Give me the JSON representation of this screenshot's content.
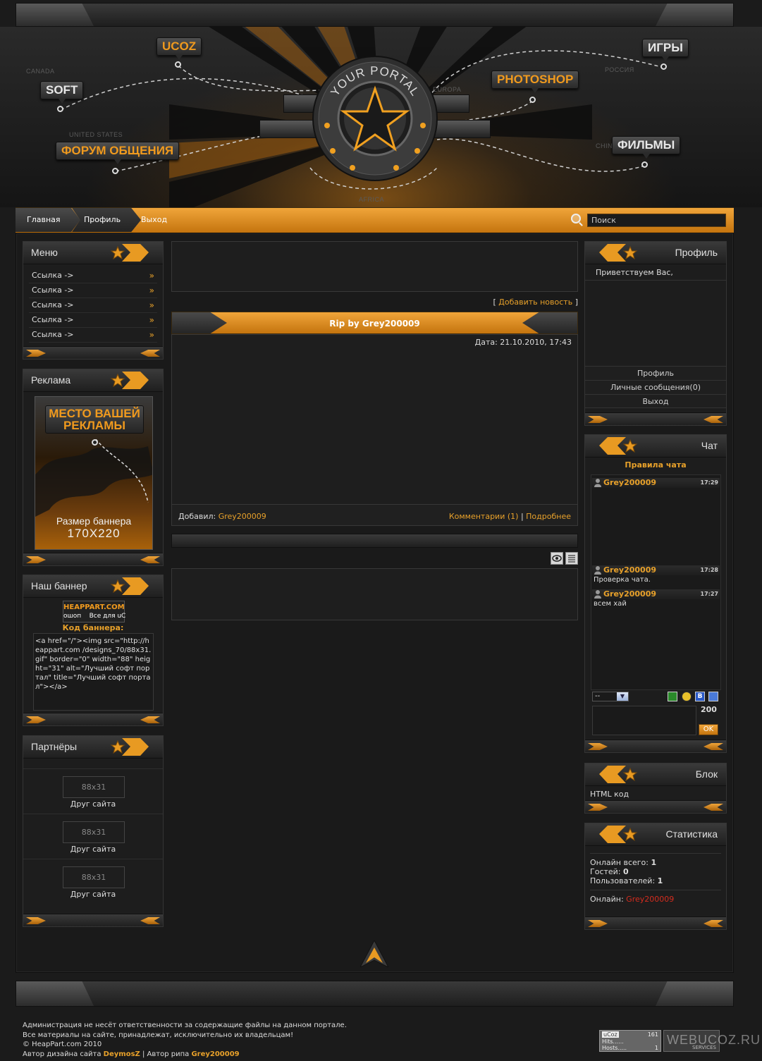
{
  "header": {
    "map_labels": [
      "CANADA",
      "UNITED STATES",
      "EUROPA",
      "AFRICA",
      "РОССИЯ",
      "CHINA"
    ],
    "logo_text": "YOUR PORTAL",
    "tags": {
      "ucoz": "UCOZ",
      "soft": "SOFT",
      "forum": "ФОРУМ ОБЩЕНИЯ",
      "photoshop": "PHOTOSHOP",
      "games": "ИГРЫ",
      "films": "ФИЛЬМЫ"
    }
  },
  "nav": {
    "items": [
      "Главная",
      "Профиль",
      "Выход"
    ],
    "search_placeholder": "Поиск"
  },
  "left": {
    "menu": {
      "title": "Меню",
      "items": [
        "Ссылка ->",
        "Ссылка ->",
        "Ссылка ->",
        "Ссылка ->",
        "Ссылка ->"
      ]
    },
    "ads": {
      "title": "Реклама",
      "banner_title": "МЕСТО ВАШЕЙ РЕКЛАМЫ",
      "banner_size_label": "Размер баннера",
      "banner_size_value": "170X220"
    },
    "our_banner": {
      "title": "Наш баннер",
      "image_line1": "HEAPPART.COM",
      "image_line2": "ошоп    Все для uC",
      "code_title": "Код баннера:",
      "code": "<a href=\"/\"><img src=\"http://heappart.com /designs_70/88x31.gif\" border=\"0\" width=\"88\" height=\"31\" alt=\"Лучший софт портал\" title=\"Лучший софт портал\"></a>"
    },
    "partners": {
      "title": "Партнёры",
      "items": [
        {
          "box": "88x31",
          "label": "Друг сайта"
        },
        {
          "box": "88x31",
          "label": "Друг сайта"
        },
        {
          "box": "88x31",
          "label": "Друг сайта"
        }
      ]
    }
  },
  "center": {
    "add_news_open": "[ ",
    "add_news": "Добавить новость",
    "add_news_close": " ]",
    "post": {
      "title": "Rip by Grey200009",
      "date": "Дата: 21.10.2010, 17:43",
      "added_by_label": "Добавил:",
      "author": "Grey200009",
      "comments": "Комментарии (1)",
      "separator": "|",
      "more": "Подробнее"
    }
  },
  "right": {
    "profile": {
      "title": "Профиль",
      "greeting": "Приветствуем Вас,",
      "links": [
        "Профиль",
        "Личные сообщения(0)",
        "Выход"
      ]
    },
    "chat": {
      "title": "Чат",
      "rules": "Правила чата",
      "messages": [
        {
          "user": "Grey200009",
          "time": "17:29",
          "text": ""
        },
        {
          "user": "Grey200009",
          "time": "17:28",
          "text": "Проверка чата."
        },
        {
          "user": "Grey200009",
          "time": "17:27",
          "text": "всем хай"
        }
      ],
      "select_value": "--",
      "char_limit": "200",
      "ok_label": "OK"
    },
    "block": {
      "title": "Блок",
      "content": "HTML код"
    },
    "stats": {
      "title": "Статистика",
      "online_total_label": "Онлайн всего:",
      "online_total": "1",
      "guests_label": "Гостей:",
      "guests": "0",
      "users_label": "Пользователей:",
      "users": "1",
      "online_label": "Онлайн:",
      "online_user": "Grey200009"
    }
  },
  "footer": {
    "line1": "Администрация не несёт ответственности за содержащие файлы на данном портале.",
    "line2": "Все материалы на сайте, принадлежат, исключительно их владельцам!",
    "line3": "© HeapPart.com 2010",
    "design_label": "Автор дизайна сайта",
    "design_author": "DeymosZ",
    "rip_separator": "|",
    "rip_label": "Автор рипа",
    "rip_author": "Grey200009",
    "counter_title": "uCoz",
    "counter_num": "161",
    "counter_hits": "Hits......",
    "counter_hosts": "Hosts.....",
    "counter_hosts_num": "1",
    "counter2_label": "SERVICES",
    "watermark": "WEBUCOZ.RU"
  },
  "colors": {
    "accent": "#e8a12a",
    "online": "#d42c1e",
    "background": "#1b1b1b"
  }
}
